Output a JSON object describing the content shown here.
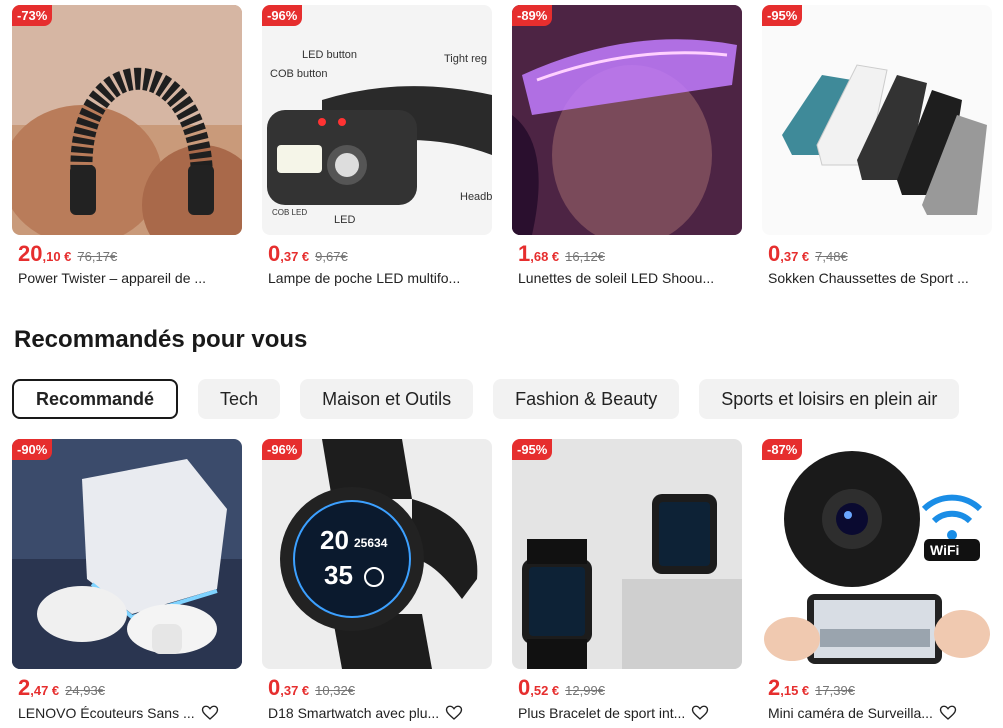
{
  "top_products": [
    {
      "badge": "-73%",
      "price_int": "20",
      "price_dec": ",10 €",
      "orig": "76,17€",
      "title": "Power Twister – appareil de ..."
    },
    {
      "badge": "-96%",
      "price_int": "0",
      "price_dec": ",37 €",
      "orig": "9,67€",
      "title": "Lampe de poche LED multifo...",
      "img_labels": [
        "LED button",
        "COB button",
        "Tight reg",
        "Headb",
        "COB LED",
        "LED"
      ]
    },
    {
      "badge": "-89%",
      "price_int": "1",
      "price_dec": ",68 €",
      "orig": "16,12€",
      "title": "Lunettes de soleil LED Shoou..."
    },
    {
      "badge": "-95%",
      "price_int": "0",
      "price_dec": ",37 €",
      "orig": "7,48€",
      "title": "Sokken Chaussettes de Sport ..."
    }
  ],
  "section_title": "Recommandés pour vous",
  "tabs": [
    {
      "label": "Recommandé",
      "active": true
    },
    {
      "label": "Tech"
    },
    {
      "label": "Maison et Outils"
    },
    {
      "label": "Fashion & Beauty"
    },
    {
      "label": "Sports et loisirs en plein air"
    }
  ],
  "rec_products": [
    {
      "badge": "-90%",
      "price_int": "2",
      "price_dec": ",47 €",
      "orig": "24,93€",
      "title": "LENOVO Écouteurs Sans ..."
    },
    {
      "badge": "-96%",
      "price_int": "0",
      "price_dec": ",37 €",
      "orig": "10,32€",
      "title": "D18 Smartwatch avec plu...",
      "watch": [
        "20",
        "25634",
        "35"
      ]
    },
    {
      "badge": "-95%",
      "price_int": "0",
      "price_dec": ",52 €",
      "orig": "12,99€",
      "title": "Plus Bracelet de sport int..."
    },
    {
      "badge": "-87%",
      "price_int": "2",
      "price_dec": ",15 €",
      "orig": "17,39€",
      "title": "Mini caméra de Surveilla...",
      "wifi": "WiFi"
    }
  ],
  "colors": {
    "accent": "#e62e2e",
    "text": "#191919"
  },
  "icons": {
    "wishlist": "heart-outline-icon"
  }
}
